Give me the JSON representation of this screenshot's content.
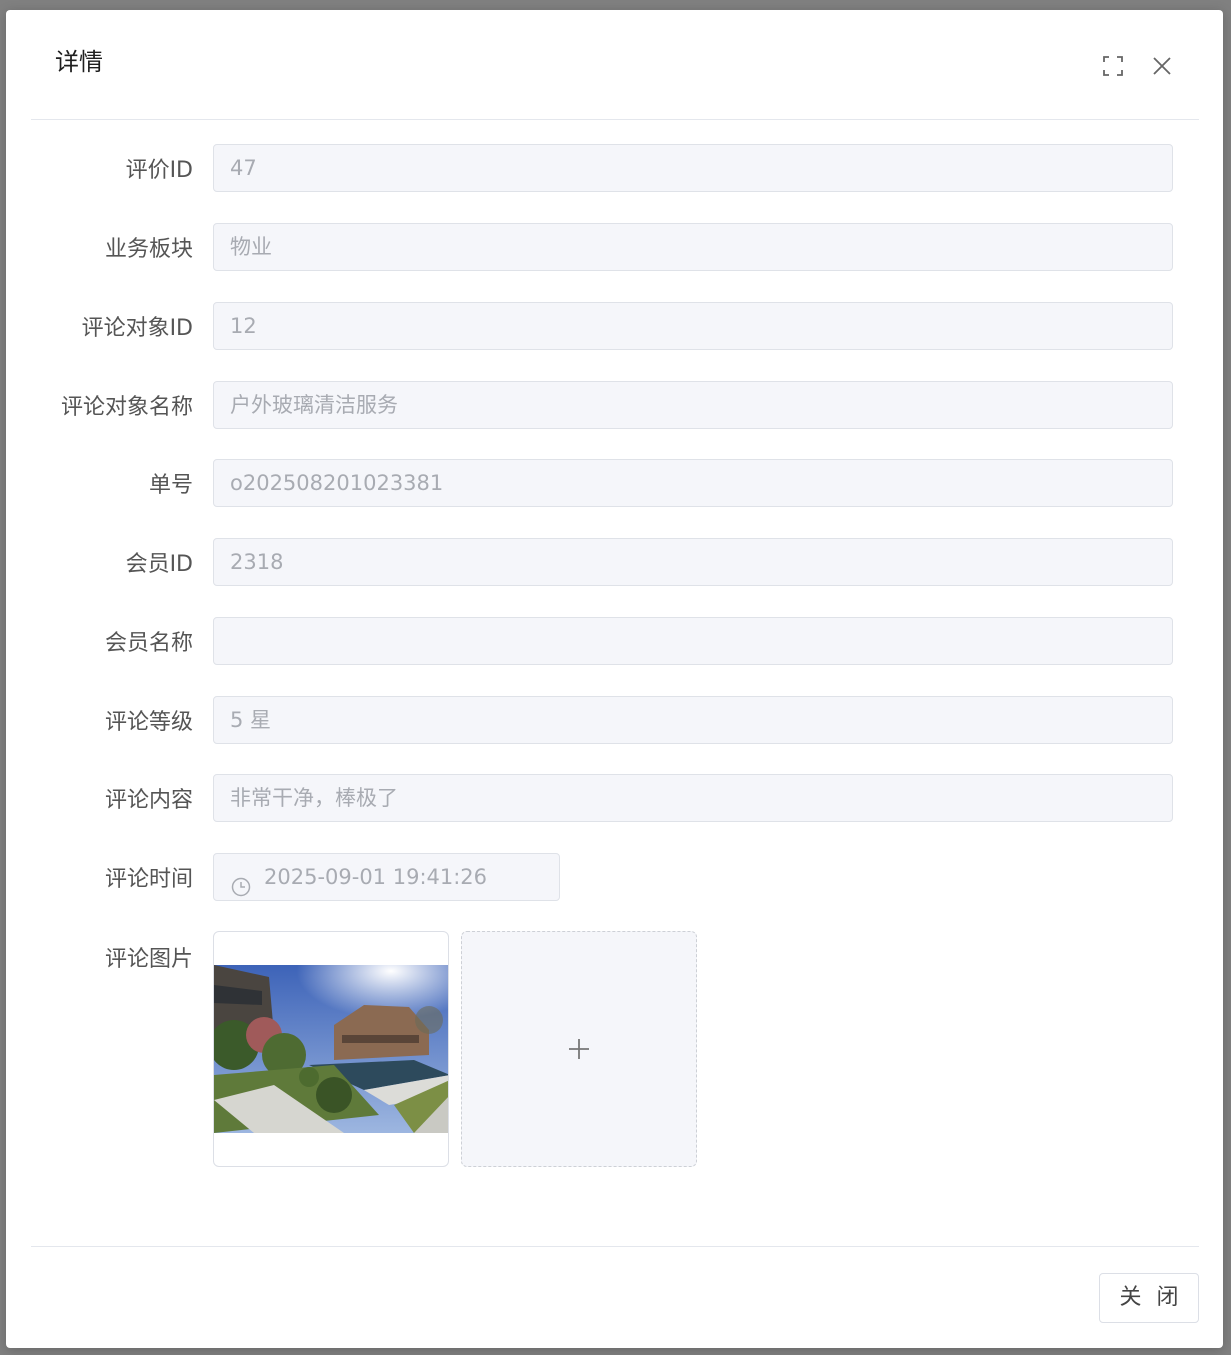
{
  "dialog": {
    "title": "详情",
    "close_label": "关 闭"
  },
  "form": {
    "fields": [
      {
        "label": "评价ID",
        "value": "47"
      },
      {
        "label": "业务板块",
        "value": "物业"
      },
      {
        "label": "评论对象ID",
        "value": "12"
      },
      {
        "label": "评论对象名称",
        "value": "户外玻璃清洁服务"
      },
      {
        "label": "单号",
        "value": "o202508201023381"
      },
      {
        "label": "会员ID",
        "value": "2318"
      },
      {
        "label": "会员名称",
        "value": ""
      },
      {
        "label": "评论等级",
        "value": "5 星"
      },
      {
        "label": "评论内容",
        "value": "非常干净，棒极了"
      },
      {
        "label": "评论时间",
        "value": "2025-09-01 19:41:26"
      }
    ],
    "image_label": "评论图片"
  },
  "icons": {
    "fullscreen": "fullscreen-icon",
    "close": "close-icon",
    "clock": "clock-icon",
    "plus": "plus-icon"
  },
  "colors": {
    "input_bg": "#f5f6fa",
    "input_text": "#a8abb2",
    "label_text": "#555555"
  }
}
